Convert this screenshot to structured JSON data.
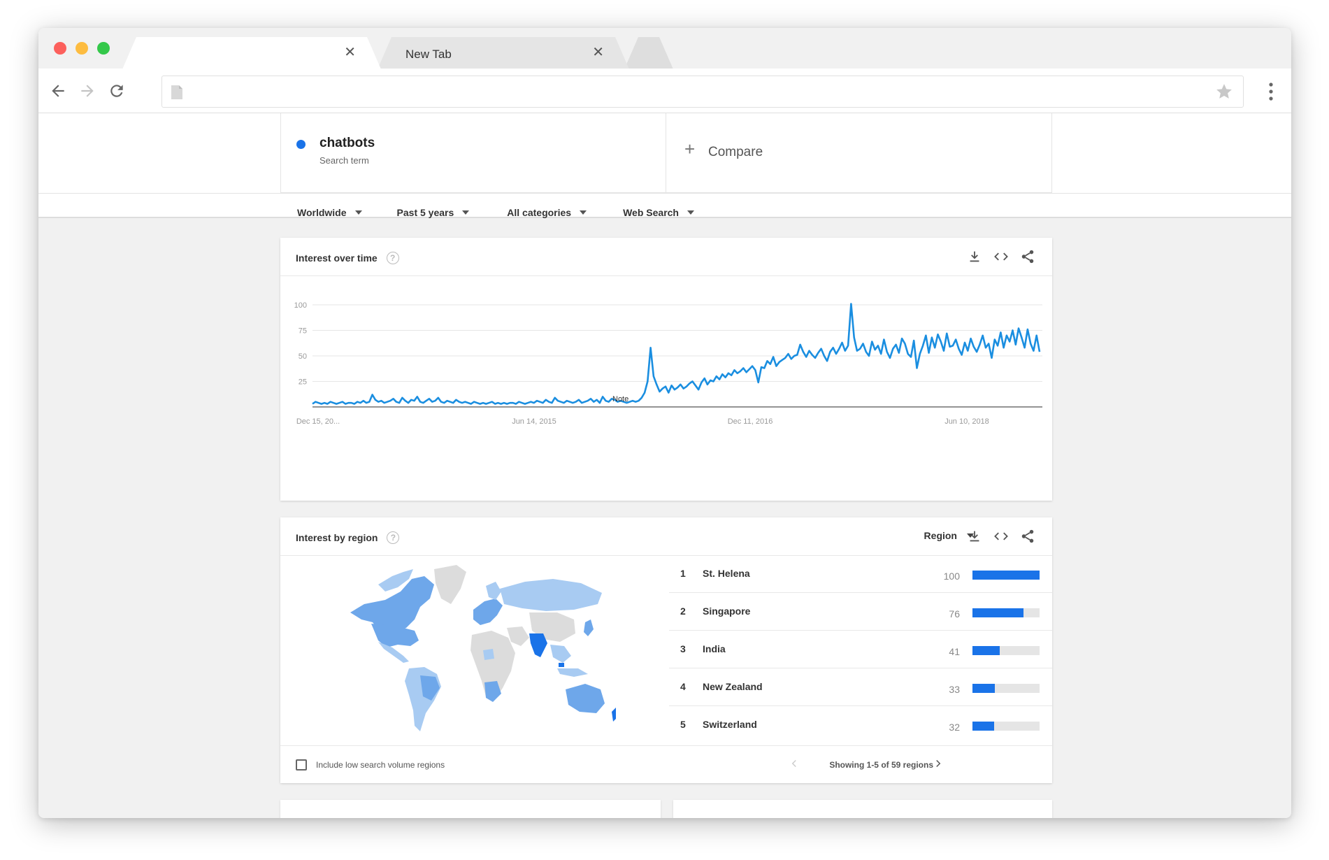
{
  "browser": {
    "tabs": [
      {
        "title": "",
        "active": true
      },
      {
        "title": "New Tab",
        "active": false
      }
    ],
    "close_glyph": "✕",
    "address": ""
  },
  "search": {
    "term": "chatbots",
    "term_type": "Search term",
    "term_color": "#1a73e8",
    "compare_label": "Compare",
    "compare_glyph": "+"
  },
  "filters": {
    "region": "Worldwide",
    "time": "Past 5 years",
    "category": "All categories",
    "property": "Web Search"
  },
  "interest_over_time": {
    "title": "Interest over time",
    "help": "?"
  },
  "chart_data": {
    "type": "line",
    "ylim": [
      0,
      100
    ],
    "yticks": [
      25,
      50,
      75,
      100
    ],
    "xtick_labels": [
      "Dec 15, 20...",
      "Jun 14, 2015",
      "Dec 11, 2016",
      "Jun 10, 2018"
    ],
    "grid": true,
    "note_label": "Note",
    "series": [
      {
        "color": "#1a8ee0",
        "values": [
          3,
          5,
          4,
          3,
          4,
          3,
          5,
          4,
          3,
          4,
          5,
          3,
          4,
          4,
          3,
          5,
          4,
          6,
          4,
          5,
          12,
          7,
          5,
          6,
          4,
          5,
          6,
          8,
          5,
          4,
          9,
          6,
          4,
          7,
          6,
          10,
          5,
          4,
          6,
          8,
          5,
          6,
          9,
          5,
          4,
          6,
          5,
          4,
          7,
          5,
          4,
          5,
          4,
          3,
          5,
          4,
          3,
          4,
          3,
          4,
          5,
          3,
          4,
          3,
          4,
          3,
          4,
          4,
          3,
          5,
          4,
          3,
          4,
          5,
          4,
          6,
          5,
          4,
          7,
          5,
          4,
          9,
          6,
          5,
          4,
          6,
          5,
          4,
          5,
          7,
          4,
          5,
          6,
          8,
          5,
          7,
          4,
          10,
          6,
          5,
          8,
          7,
          5,
          6,
          5,
          4,
          5,
          6,
          5,
          6,
          9,
          14,
          25,
          58,
          30,
          22,
          15,
          18,
          20,
          14,
          21,
          17,
          19,
          22,
          18,
          20,
          23,
          25,
          21,
          17,
          24,
          28,
          22,
          26,
          25,
          30,
          27,
          32,
          29,
          33,
          31,
          36,
          33,
          35,
          38,
          34,
          37,
          40,
          36,
          24,
          39,
          38,
          45,
          42,
          49,
          40,
          44,
          46,
          48,
          52,
          47,
          50,
          51,
          61,
          54,
          49,
          55,
          51,
          48,
          53,
          57,
          50,
          45,
          54,
          58,
          52,
          57,
          63,
          55,
          60,
          101,
          68,
          55,
          57,
          62,
          54,
          50,
          64,
          56,
          60,
          52,
          66,
          54,
          48,
          57,
          61,
          53,
          67,
          62,
          52,
          49,
          65,
          38,
          52,
          60,
          70,
          53,
          68,
          58,
          71,
          64,
          55,
          72,
          59,
          60,
          66,
          57,
          51,
          63,
          55,
          67,
          59,
          54,
          61,
          70,
          58,
          62,
          48,
          66,
          60,
          73,
          58,
          70,
          64,
          75,
          61,
          77,
          68,
          58,
          76,
          62,
          55,
          70,
          54
        ]
      }
    ]
  },
  "interest_by_region": {
    "title": "Interest by region",
    "help": "?",
    "view_select": "Region",
    "rows": [
      {
        "rank": "1",
        "name": "St. Helena",
        "value": 100
      },
      {
        "rank": "2",
        "name": "Singapore",
        "value": 76
      },
      {
        "rank": "3",
        "name": "India",
        "value": 41
      },
      {
        "rank": "4",
        "name": "New Zealand",
        "value": 33
      },
      {
        "rank": "5",
        "name": "Switzerland",
        "value": 32
      }
    ],
    "checkbox_label": "Include low search volume regions",
    "pager_label": "Showing 1-5 of 59 regions"
  },
  "colors": {
    "accent": "#1a73e8",
    "map_light": "#a8cbf2",
    "map_medium": "#6ea7ea",
    "map_gray": "#dcdcdc"
  }
}
